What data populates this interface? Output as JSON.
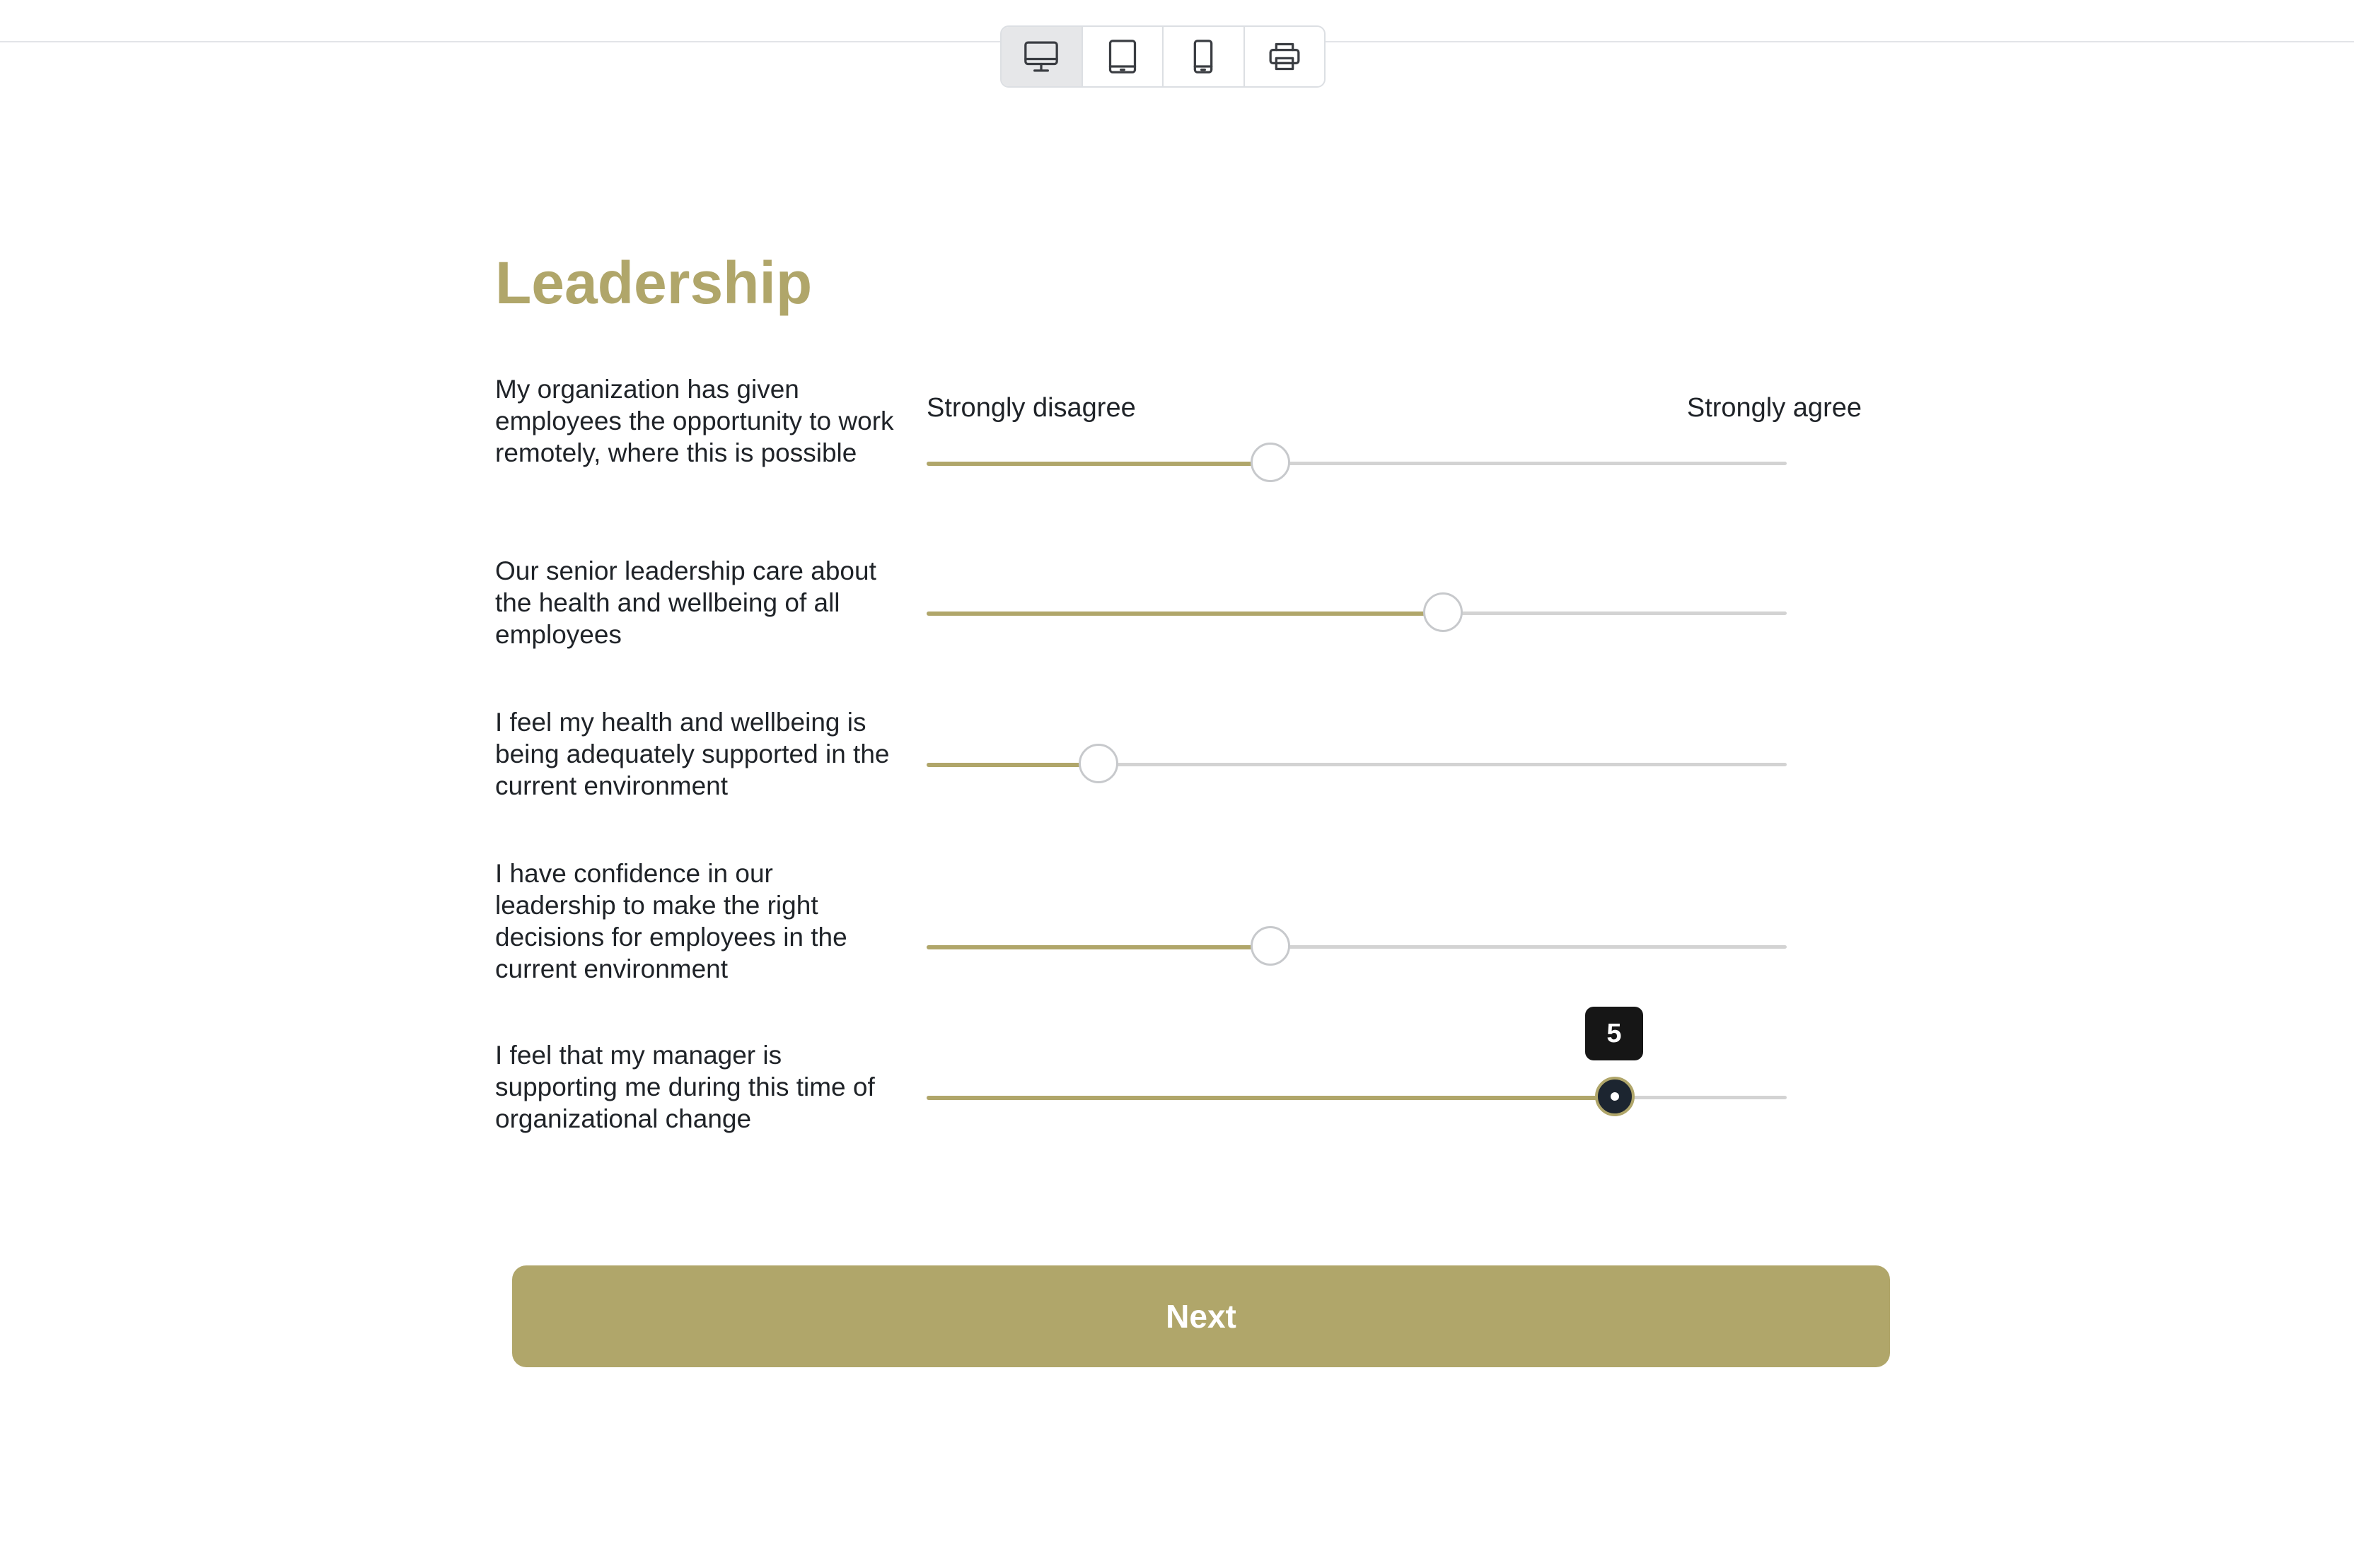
{
  "toolbar": {
    "items": [
      {
        "name": "desktop-icon",
        "active": true
      },
      {
        "name": "tablet-icon",
        "active": false
      },
      {
        "name": "mobile-icon",
        "active": false
      },
      {
        "name": "print-icon",
        "active": false
      }
    ]
  },
  "section": {
    "title": "Leadership"
  },
  "scale": {
    "min_label": "Strongly disagree",
    "max_label": "Strongly agree"
  },
  "questions": [
    {
      "text": "My organization has given employees the opportunity to work remotely, where this is possible",
      "position": 0.4
    },
    {
      "text": "Our senior leadership care about the health and wellbeing of all employees",
      "position": 0.6
    },
    {
      "text": "I feel my health and wellbeing is being adequately supported in the current environment",
      "position": 0.2
    },
    {
      "text": "I have confidence in our leadership to make the right decisions for employees in the current environment",
      "position": 0.4
    },
    {
      "text": "I feel that my manager is supporting me during this time of organizational change",
      "position": 0.8,
      "active": true,
      "tooltip": "5"
    }
  ],
  "next_button": {
    "label": "Next"
  },
  "colors": {
    "accent": "#b0a66a",
    "track": "#d3d3d3",
    "text": "#1f2328",
    "tooltip_bg": "#161616",
    "active_thumb": "#1c2530"
  }
}
